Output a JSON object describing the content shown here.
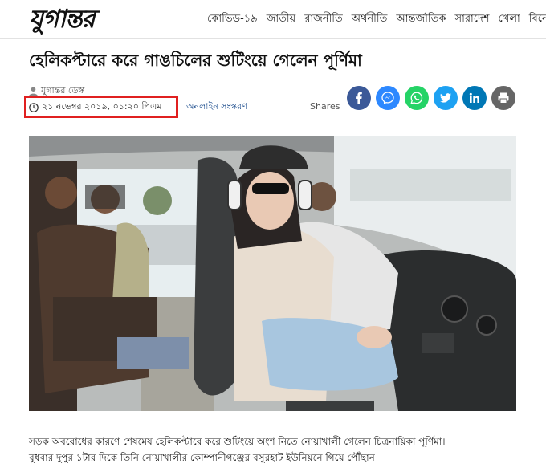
{
  "site": {
    "logo_text": "যুগান্তর"
  },
  "nav": {
    "items": [
      "কোভিড-১৯",
      "জাতীয়",
      "রাজনীতি",
      "অর্থনীতি",
      "আন্তর্জাতিক",
      "সারাদেশ",
      "খেলা",
      "বিনোদন"
    ]
  },
  "article": {
    "headline": "হেলিকপ্টারে করে গাঙচিলের শুটিংয়ে গেলেন পূর্ণিমা",
    "author": "যুগান্তর ডেস্ক",
    "published": "২১ নভেম্বর ২০১৯, ০১:২০ পিএম",
    "edition": "অনলাইন সংস্করণ",
    "body_line_1": "সড়ক অবরোধের কারণে শেষমেষ হেলিকপ্টারে করে শুটিংয়ে অংশ নিতে নোয়াখালী গেলেন চিত্রনায়িকা পূর্ণিমা।",
    "body_line_2": "বুধবার দুপুর ১টার দিকে তিনি নোয়াখালীর কোম্পানীগঞ্জের বসুরহাট ইউনিয়নে গিয়ে পৌঁছান।"
  },
  "share": {
    "label": "Shares",
    "buttons": [
      {
        "name": "facebook",
        "color": "#3b5998"
      },
      {
        "name": "messenger",
        "color": "#2d88ff"
      },
      {
        "name": "whatsapp",
        "color": "#25d366"
      },
      {
        "name": "twitter",
        "color": "#1da1f2"
      },
      {
        "name": "linkedin",
        "color": "#0077b5"
      },
      {
        "name": "print",
        "color": "#666666"
      }
    ]
  },
  "colors": {
    "highlight_box": "#e02020",
    "edition_link": "#1a4b8c"
  }
}
